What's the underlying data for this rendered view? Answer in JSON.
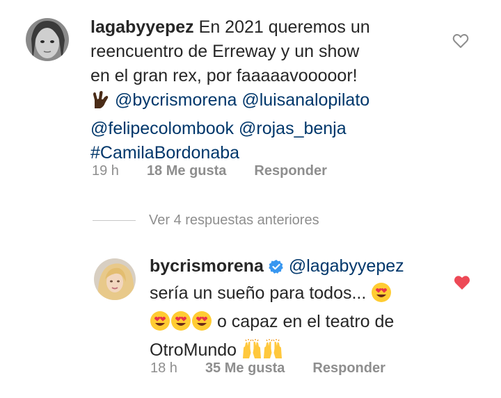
{
  "comment1": {
    "username": "lagabyyepez",
    "text_line1": "En 2021 queremos un",
    "text_line2": "reencuentro de Erreway y un show",
    "text_line3": "en el gran rex, por faaaaavooooor!",
    "mention1": "@bycrismorena",
    "mention2": "@luisanalopilato",
    "mention3": "@felipecolombook",
    "mention4": "@rojas_benja",
    "hashtag": "#CamilaBordonaba",
    "time": "19 h",
    "likes": "18 Me gusta",
    "reply_label": "Responder",
    "liked": false
  },
  "view_replies": "Ver 4 respuestas anteriores",
  "comment2": {
    "username": "bycrismorena",
    "verified": true,
    "mention": "@lagabyyepez",
    "text_line2": "sería un sueño para todos...",
    "text_line3": "o capaz en el teatro de",
    "text_line4": "OtroMundo",
    "time": "18 h",
    "likes": "35 Me gusta",
    "reply_label": "Responder",
    "liked": true
  },
  "colors": {
    "link": "#00376b",
    "muted": "#8e8e8e",
    "like_red": "#ed4956"
  },
  "icons": [
    "heart-outline-icon",
    "heart-filled-icon",
    "verified-badge-icon",
    "heart-eyes-emoji",
    "raising-hands-emoji",
    "rock-on-hand-emoji"
  ]
}
